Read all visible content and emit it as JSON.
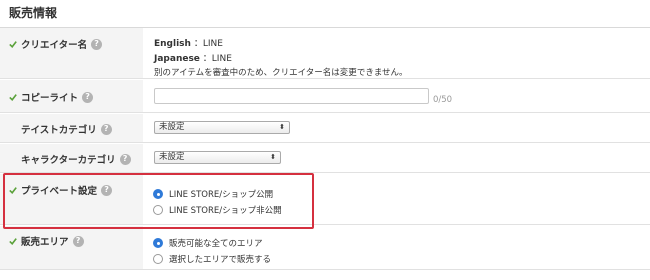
{
  "section": {
    "title": "販売情報"
  },
  "creator": {
    "label": "クリエイター名",
    "english_label": "English",
    "english_value": "：LINE",
    "japanese_label": "Japanese",
    "japanese_value": "：LINE",
    "note": "別のアイテムを審査中のため、クリエイター名は変更できません。"
  },
  "copyright": {
    "label": "コピーライト",
    "value": "",
    "counter": "0/50"
  },
  "taste_category": {
    "label": "テイストカテゴリ",
    "selected": "未設定"
  },
  "character_category": {
    "label": "キャラクターカテゴリ",
    "selected": "未設定"
  },
  "private_setting": {
    "label": "プライベート設定",
    "options": [
      {
        "label": "LINE STORE/ショップ公開",
        "checked": true
      },
      {
        "label": "LINE STORE/ショップ非公開",
        "checked": false
      }
    ]
  },
  "sales_area": {
    "label": "販売エリア",
    "options": [
      {
        "label": "販売可能な全てのエリア",
        "checked": true
      },
      {
        "label": "選択したエリアで販売する",
        "checked": false
      }
    ]
  },
  "icons": {
    "check": "check-icon",
    "help": "help-icon",
    "select_arrow": "updown-arrow-icon"
  },
  "colors": {
    "check": "#5aa13a",
    "radio_selected": "#2f7ad8",
    "highlight": "#d5303f",
    "help_badge": "#b3b3b3"
  }
}
